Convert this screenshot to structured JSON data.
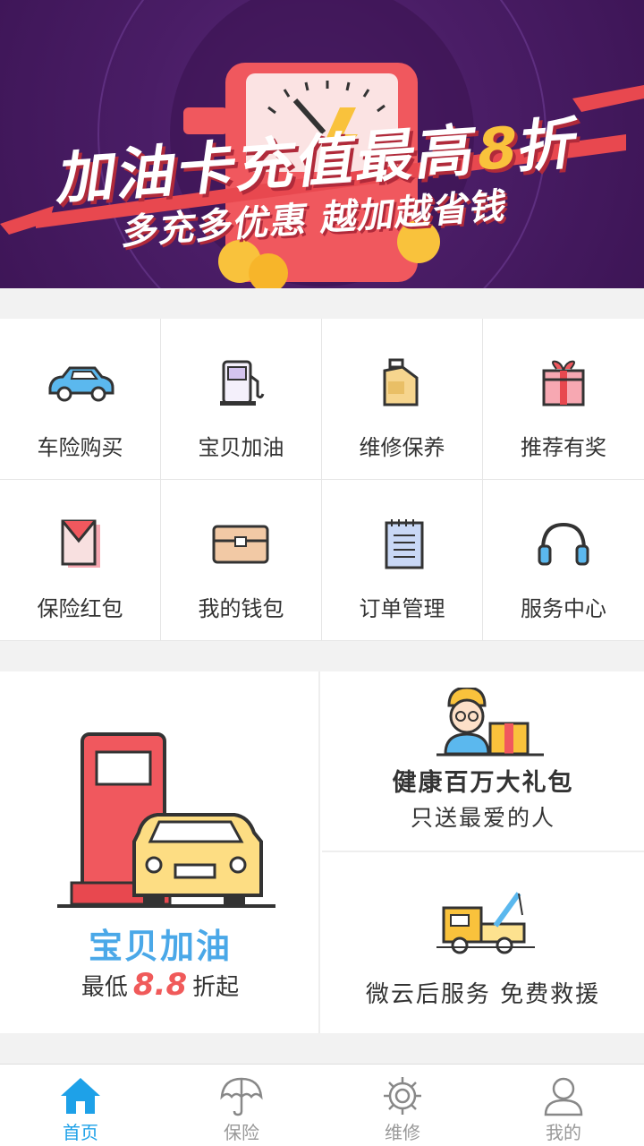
{
  "banner": {
    "title_main": "加油卡充值最高",
    "title_highlight": "8",
    "title_suffix": "折",
    "subtitle": "多充多优惠 越加越省钱"
  },
  "menu": [
    {
      "label": "车险购买",
      "icon": "car-icon"
    },
    {
      "label": "宝贝加油",
      "icon": "fuel-pump-icon"
    },
    {
      "label": "维修保养",
      "icon": "oil-can-icon"
    },
    {
      "label": "推荐有奖",
      "icon": "gift-icon"
    },
    {
      "label": "保险红包",
      "icon": "red-envelope-icon"
    },
    {
      "label": "我的钱包",
      "icon": "wallet-icon"
    },
    {
      "label": "订单管理",
      "icon": "notepad-icon"
    },
    {
      "label": "服务中心",
      "icon": "headphones-icon"
    }
  ],
  "promo": {
    "fuel": {
      "title": "宝贝加油",
      "prefix": "最低",
      "discount": "8.8",
      "suffix": "折起"
    },
    "health": {
      "title": "健康百万大礼包",
      "subtitle": "只送最爱的人"
    },
    "rescue": {
      "title": "微云后服务 免费救援"
    }
  },
  "tabs": [
    {
      "label": "首页",
      "icon": "home-icon",
      "active": true
    },
    {
      "label": "保险",
      "icon": "umbrella-icon",
      "active": false
    },
    {
      "label": "维修",
      "icon": "gear-icon",
      "active": false
    },
    {
      "label": "我的",
      "icon": "user-icon",
      "active": false
    }
  ],
  "colors": {
    "accent": "#1ea1e8",
    "banner_bg": "#4a1d66",
    "promo_blue": "#4aa8e8",
    "discount_red": "#f05a5a"
  }
}
